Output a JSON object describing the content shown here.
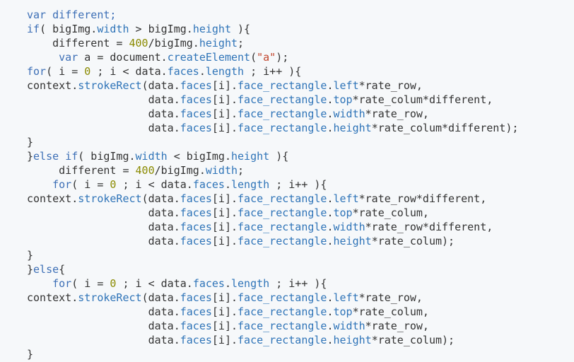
{
  "code_view": {
    "lines": [
      [
        {
          "t": "var",
          "c": "kw"
        },
        {
          "t": " different;",
          "c": "kw"
        }
      ],
      [
        {
          "t": "if",
          "c": "kw"
        },
        {
          "t": "( bigImg.",
          "c": "plain"
        },
        {
          "t": "width",
          "c": "prop"
        },
        {
          "t": " > bigImg.",
          "c": "plain"
        },
        {
          "t": "height",
          "c": "prop"
        },
        {
          "t": " ){",
          "c": "plain"
        }
      ],
      [
        {
          "t": "    different = ",
          "c": "plain"
        },
        {
          "t": "400",
          "c": "num"
        },
        {
          "t": "/bigImg.",
          "c": "plain"
        },
        {
          "t": "height",
          "c": "prop"
        },
        {
          "t": ";",
          "c": "plain"
        }
      ],
      [
        {
          "t": "     ",
          "c": "plain"
        },
        {
          "t": "var",
          "c": "kw"
        },
        {
          "t": " a = document.",
          "c": "plain"
        },
        {
          "t": "createElement",
          "c": "prop"
        },
        {
          "t": "(",
          "c": "plain"
        },
        {
          "t": "\"a\"",
          "c": "str"
        },
        {
          "t": ");",
          "c": "plain"
        }
      ],
      [
        {
          "t": "for",
          "c": "kw"
        },
        {
          "t": "( i = ",
          "c": "plain"
        },
        {
          "t": "0",
          "c": "num"
        },
        {
          "t": " ; i < data.",
          "c": "plain"
        },
        {
          "t": "faces",
          "c": "prop"
        },
        {
          "t": ".",
          "c": "plain"
        },
        {
          "t": "length",
          "c": "prop"
        },
        {
          "t": " ; i++ ){",
          "c": "plain"
        }
      ],
      [
        {
          "t": "context.",
          "c": "plain"
        },
        {
          "t": "strokeRect",
          "c": "prop"
        },
        {
          "t": "(data.",
          "c": "plain"
        },
        {
          "t": "faces",
          "c": "prop"
        },
        {
          "t": "[i].",
          "c": "plain"
        },
        {
          "t": "face_rectangle",
          "c": "prop"
        },
        {
          "t": ".",
          "c": "plain"
        },
        {
          "t": "left",
          "c": "prop"
        },
        {
          "t": "*rate_row,",
          "c": "plain"
        }
      ],
      [
        {
          "t": "                   data.",
          "c": "plain"
        },
        {
          "t": "faces",
          "c": "prop"
        },
        {
          "t": "[i].",
          "c": "plain"
        },
        {
          "t": "face_rectangle",
          "c": "prop"
        },
        {
          "t": ".",
          "c": "plain"
        },
        {
          "t": "top",
          "c": "prop"
        },
        {
          "t": "*rate_colum*different,",
          "c": "plain"
        }
      ],
      [
        {
          "t": "                   data.",
          "c": "plain"
        },
        {
          "t": "faces",
          "c": "prop"
        },
        {
          "t": "[i].",
          "c": "plain"
        },
        {
          "t": "face_rectangle",
          "c": "prop"
        },
        {
          "t": ".",
          "c": "plain"
        },
        {
          "t": "width",
          "c": "prop"
        },
        {
          "t": "*rate_row,",
          "c": "plain"
        }
      ],
      [
        {
          "t": "                   data.",
          "c": "plain"
        },
        {
          "t": "faces",
          "c": "prop"
        },
        {
          "t": "[i].",
          "c": "plain"
        },
        {
          "t": "face_rectangle",
          "c": "prop"
        },
        {
          "t": ".",
          "c": "plain"
        },
        {
          "t": "height",
          "c": "prop"
        },
        {
          "t": "*rate_colum*different);",
          "c": "plain"
        }
      ],
      [
        {
          "t": "}",
          "c": "plain"
        }
      ],
      [
        {
          "t": "}",
          "c": "plain"
        },
        {
          "t": "else",
          "c": "kw"
        },
        {
          "t": " ",
          "c": "plain"
        },
        {
          "t": "if",
          "c": "kw"
        },
        {
          "t": "( bigImg.",
          "c": "plain"
        },
        {
          "t": "width",
          "c": "prop"
        },
        {
          "t": " < bigImg.",
          "c": "plain"
        },
        {
          "t": "height",
          "c": "prop"
        },
        {
          "t": " ){",
          "c": "plain"
        }
      ],
      [
        {
          "t": "     different = ",
          "c": "plain"
        },
        {
          "t": "400",
          "c": "num"
        },
        {
          "t": "/bigImg.",
          "c": "plain"
        },
        {
          "t": "width",
          "c": "prop"
        },
        {
          "t": ";",
          "c": "plain"
        }
      ],
      [
        {
          "t": "    ",
          "c": "plain"
        },
        {
          "t": "for",
          "c": "kw"
        },
        {
          "t": "( i = ",
          "c": "plain"
        },
        {
          "t": "0",
          "c": "num"
        },
        {
          "t": " ; i < data.",
          "c": "plain"
        },
        {
          "t": "faces",
          "c": "prop"
        },
        {
          "t": ".",
          "c": "plain"
        },
        {
          "t": "length",
          "c": "prop"
        },
        {
          "t": " ; i++ ){",
          "c": "plain"
        }
      ],
      [
        {
          "t": "context.",
          "c": "plain"
        },
        {
          "t": "strokeRect",
          "c": "prop"
        },
        {
          "t": "(data.",
          "c": "plain"
        },
        {
          "t": "faces",
          "c": "prop"
        },
        {
          "t": "[i].",
          "c": "plain"
        },
        {
          "t": "face_rectangle",
          "c": "prop"
        },
        {
          "t": ".",
          "c": "plain"
        },
        {
          "t": "left",
          "c": "prop"
        },
        {
          "t": "*rate_row*different,",
          "c": "plain"
        }
      ],
      [
        {
          "t": "                   data.",
          "c": "plain"
        },
        {
          "t": "faces",
          "c": "prop"
        },
        {
          "t": "[i].",
          "c": "plain"
        },
        {
          "t": "face_rectangle",
          "c": "prop"
        },
        {
          "t": ".",
          "c": "plain"
        },
        {
          "t": "top",
          "c": "prop"
        },
        {
          "t": "*rate_colum,",
          "c": "plain"
        }
      ],
      [
        {
          "t": "                   data.",
          "c": "plain"
        },
        {
          "t": "faces",
          "c": "prop"
        },
        {
          "t": "[i].",
          "c": "plain"
        },
        {
          "t": "face_rectangle",
          "c": "prop"
        },
        {
          "t": ".",
          "c": "plain"
        },
        {
          "t": "width",
          "c": "prop"
        },
        {
          "t": "*rate_row*different,",
          "c": "plain"
        }
      ],
      [
        {
          "t": "                   data.",
          "c": "plain"
        },
        {
          "t": "faces",
          "c": "prop"
        },
        {
          "t": "[i].",
          "c": "plain"
        },
        {
          "t": "face_rectangle",
          "c": "prop"
        },
        {
          "t": ".",
          "c": "plain"
        },
        {
          "t": "height",
          "c": "prop"
        },
        {
          "t": "*rate_colum);",
          "c": "plain"
        }
      ],
      [
        {
          "t": "}",
          "c": "plain"
        }
      ],
      [
        {
          "t": "}",
          "c": "plain"
        },
        {
          "t": "else",
          "c": "kw"
        },
        {
          "t": "{",
          "c": "plain"
        }
      ],
      [
        {
          "t": "    ",
          "c": "plain"
        },
        {
          "t": "for",
          "c": "kw"
        },
        {
          "t": "( i = ",
          "c": "plain"
        },
        {
          "t": "0",
          "c": "num"
        },
        {
          "t": " ; i < data.",
          "c": "plain"
        },
        {
          "t": "faces",
          "c": "prop"
        },
        {
          "t": ".",
          "c": "plain"
        },
        {
          "t": "length",
          "c": "prop"
        },
        {
          "t": " ; i++ ){",
          "c": "plain"
        }
      ],
      [
        {
          "t": "context.",
          "c": "plain"
        },
        {
          "t": "strokeRect",
          "c": "prop"
        },
        {
          "t": "(data.",
          "c": "plain"
        },
        {
          "t": "faces",
          "c": "prop"
        },
        {
          "t": "[i].",
          "c": "plain"
        },
        {
          "t": "face_rectangle",
          "c": "prop"
        },
        {
          "t": ".",
          "c": "plain"
        },
        {
          "t": "left",
          "c": "prop"
        },
        {
          "t": "*rate_row,",
          "c": "plain"
        }
      ],
      [
        {
          "t": "                   data.",
          "c": "plain"
        },
        {
          "t": "faces",
          "c": "prop"
        },
        {
          "t": "[i].",
          "c": "plain"
        },
        {
          "t": "face_rectangle",
          "c": "prop"
        },
        {
          "t": ".",
          "c": "plain"
        },
        {
          "t": "top",
          "c": "prop"
        },
        {
          "t": "*rate_colum,",
          "c": "plain"
        }
      ],
      [
        {
          "t": "                   data.",
          "c": "plain"
        },
        {
          "t": "faces",
          "c": "prop"
        },
        {
          "t": "[i].",
          "c": "plain"
        },
        {
          "t": "face_rectangle",
          "c": "prop"
        },
        {
          "t": ".",
          "c": "plain"
        },
        {
          "t": "width",
          "c": "prop"
        },
        {
          "t": "*rate_row,",
          "c": "plain"
        }
      ],
      [
        {
          "t": "                   data.",
          "c": "plain"
        },
        {
          "t": "faces",
          "c": "prop"
        },
        {
          "t": "[i].",
          "c": "plain"
        },
        {
          "t": "face_rectangle",
          "c": "prop"
        },
        {
          "t": ".",
          "c": "plain"
        },
        {
          "t": "height",
          "c": "prop"
        },
        {
          "t": "*rate_colum);",
          "c": "plain"
        }
      ],
      [
        {
          "t": "}",
          "c": "plain"
        }
      ]
    ]
  }
}
